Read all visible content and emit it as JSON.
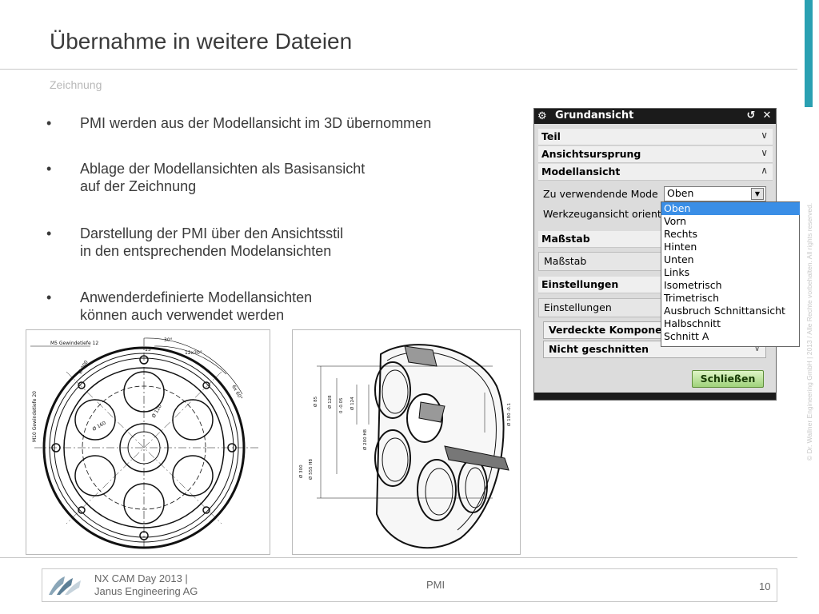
{
  "slide": {
    "title": "Übernahme in weitere Dateien",
    "subtitle": "Zeichnung",
    "bullets": [
      "PMI werden aus der Modellansicht im 3D übernommen",
      "Ablage der Modellansichten als Basisansicht\nauf der Zeichnung",
      "Darstellung der PMI über den Ansichtsstil\nin den entsprechenden Modelansichten",
      "Anwenderdefinierte Modellansichten\nkönnen auch verwendet werden"
    ],
    "bullet_char": "•",
    "copyright": "© Dr. Wallner Engineering GmbH | 2013 / Alle Rechte vorbehalten. All rights reserved."
  },
  "dialog": {
    "title": "Grundansicht",
    "reset_icon": "↺",
    "close_icon": "✕",
    "sections": {
      "teil": "Teil",
      "ansichtsursprung": "Ansichtsursprung",
      "modellansicht": "Modellansicht",
      "massstab": "Maßstab",
      "einstellungen": "Einstellungen"
    },
    "rows": {
      "zu_verwendende_mode": "Zu verwendende Mode",
      "werkzeugansicht": "Werkzeugansicht orient",
      "massstab": "Maßstab",
      "einstellungen": "Einstellungen"
    },
    "combo_value": "Oben",
    "inner_rows": {
      "verdeckte": "Verdeckte Komponen",
      "nicht_geschnitten": "Nicht geschnitten"
    },
    "close_button": "Schließen",
    "dropdown_options": [
      "Oben",
      "Vorn",
      "Rechts",
      "Hinten",
      "Unten",
      "Links",
      "Isometrisch",
      "Trimetrisch",
      "Ausbruch Schnittansicht",
      "Halbschnitt",
      "Schnitt A"
    ],
    "dropdown_selected": "Oben"
  },
  "drawing_left": {
    "annotations": [
      "M5 Gewindetiefe 12",
      "15°",
      "30°",
      "12x30°",
      "M10 Gewindetiefe 20",
      "6x 60°",
      "Ø 160",
      "Ø 120",
      "Ø 200"
    ]
  },
  "drawing_right": {
    "annotations": [
      "Ø 85",
      "Ø 128",
      "0 -0.05",
      "Ø 124",
      "Ø 200 H8",
      "Ø 180 -0.1",
      "Ø 300",
      "Ø 555 H8"
    ]
  },
  "footer": {
    "company": "NX CAM Day 2013 |\nJanus Engineering AG",
    "topic": "PMI",
    "page": "10"
  },
  "colors": {
    "accent": "#2aa0b2",
    "dialog_title_bg": "#1b1b1b",
    "selection": "#3a8ee6",
    "close_button": "#9fd27a"
  }
}
